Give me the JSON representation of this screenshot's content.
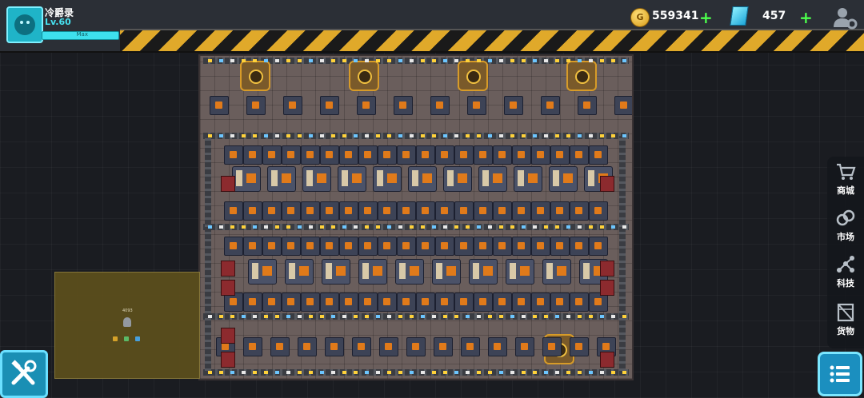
{
  "player": {
    "name": "冷爵录",
    "level": "Lv.60",
    "xp_label": "Max",
    "xp_fraction": 1.0
  },
  "currency": {
    "coin_symbol": "G",
    "coins": "559341",
    "gems": "457"
  },
  "menu": {
    "items": [
      {
        "label": "商城",
        "icon": "shopping-cart-icon"
      },
      {
        "label": "市场",
        "icon": "market-link-icon"
      },
      {
        "label": "科技",
        "icon": "tech-network-icon"
      },
      {
        "label": "货物",
        "icon": "cargo-crate-icon"
      }
    ]
  },
  "minimap": {
    "label": "4093"
  },
  "colors": {
    "accent": "#3ee0ee",
    "hazard_yellow": "#e0a92a",
    "currency_plus": "#4cff4c",
    "factory_floor": "#6a5e5c"
  }
}
